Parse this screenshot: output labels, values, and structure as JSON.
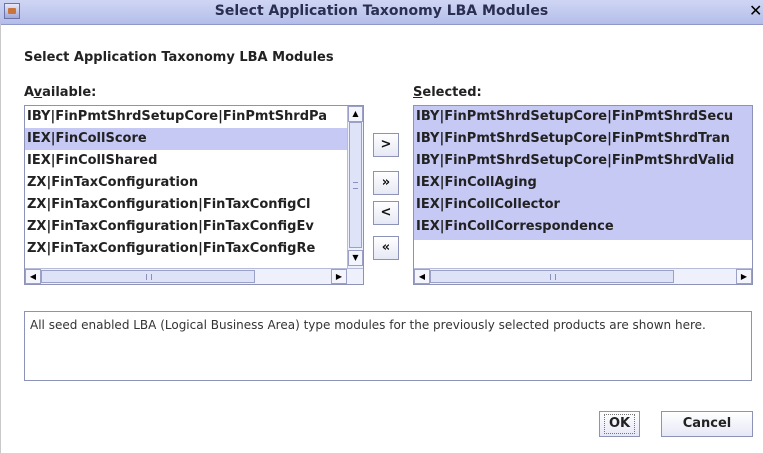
{
  "window": {
    "title": "Select Application Taxonomy LBA Modules",
    "close_glyph": "✕"
  },
  "heading": "Select Application Taxonomy LBA Modules",
  "available": {
    "label_prefix": "A",
    "label_accel": "v",
    "label_rest": "ailable:",
    "items": [
      "IBY|FinPmtShrdSetupCore|FinPmtShrdPa",
      "IEX|FinCollScore",
      "IEX|FinCollShared",
      "ZX|FinTaxConfiguration",
      "ZX|FinTaxConfiguration|FinTaxConfigCl",
      "ZX|FinTaxConfiguration|FinTaxConfigEv",
      "ZX|FinTaxConfiguration|FinTaxConfigRe"
    ],
    "selected_index": 1
  },
  "selected": {
    "label_accel": "S",
    "label_rest": "elected:",
    "items": [
      "IBY|FinPmtShrdSetupCore|FinPmtShrdSecu",
      "IBY|FinPmtShrdSetupCore|FinPmtShrdTran",
      "IBY|FinPmtShrdSetupCore|FinPmtShrdValid",
      "IEX|FinCollAging",
      "IEX|FinCollCollector",
      "IEX|FinCollCorrespondence"
    ]
  },
  "move_buttons": {
    "add_one": ">",
    "add_all": "»",
    "remove_one": "<",
    "remove_all": "«"
  },
  "scroll_glyphs": {
    "up": "▲",
    "down": "▼",
    "left": "◀",
    "right": "▶"
  },
  "description": "All seed enabled LBA (Logical Business Area) type modules for the previously selected products are shown here.",
  "buttons": {
    "ok": "OK",
    "cancel": "Cancel"
  }
}
